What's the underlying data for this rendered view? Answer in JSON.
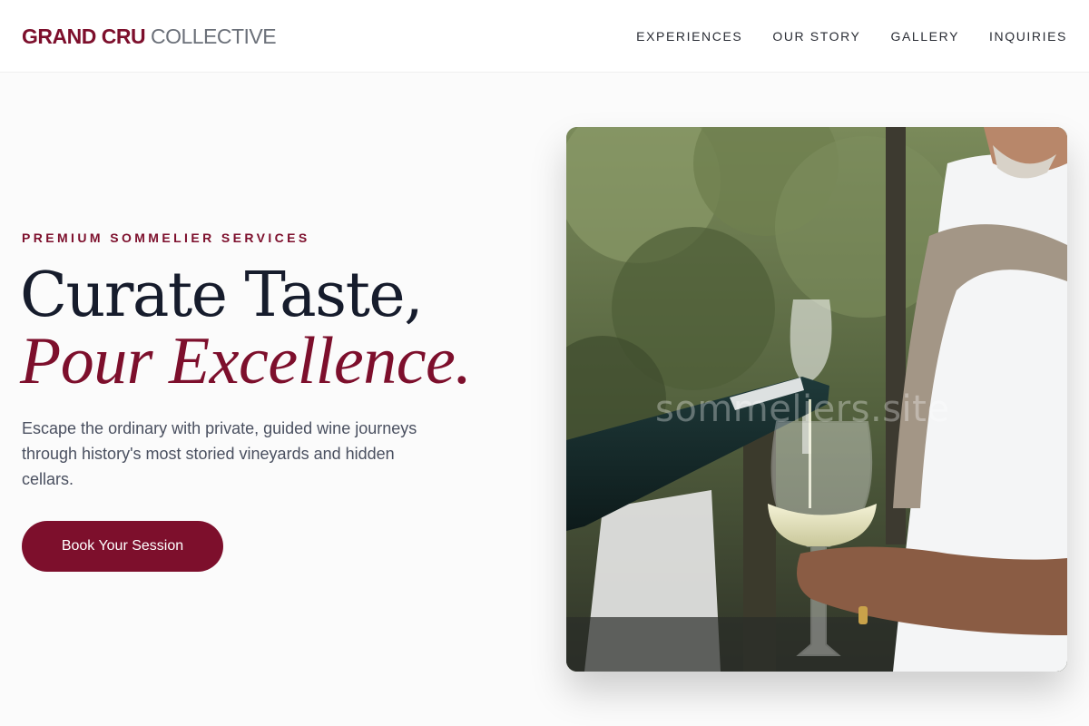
{
  "header": {
    "brand_strong": "GRAND CRU",
    "brand_light": "COLLECTIVE",
    "nav": [
      {
        "label": "EXPERIENCES"
      },
      {
        "label": "OUR STORY"
      },
      {
        "label": "GALLERY"
      },
      {
        "label": "INQUIRIES"
      }
    ]
  },
  "hero": {
    "eyebrow": "PREMIUM SOMMELIER SERVICES",
    "headline_line1": "Curate Taste,",
    "headline_line2": "Pour Excellence.",
    "lead": "Escape the ordinary with private, guided wine journeys through history's most storied vineyards and hidden cellars.",
    "cta_label": "Book Your Session",
    "image": {
      "watermark": "sommeliers.site"
    }
  },
  "colors": {
    "accent": "#7d0f2c",
    "heading": "#161c2c",
    "body_text": "#4a5060",
    "background": "#fbfbfb"
  }
}
